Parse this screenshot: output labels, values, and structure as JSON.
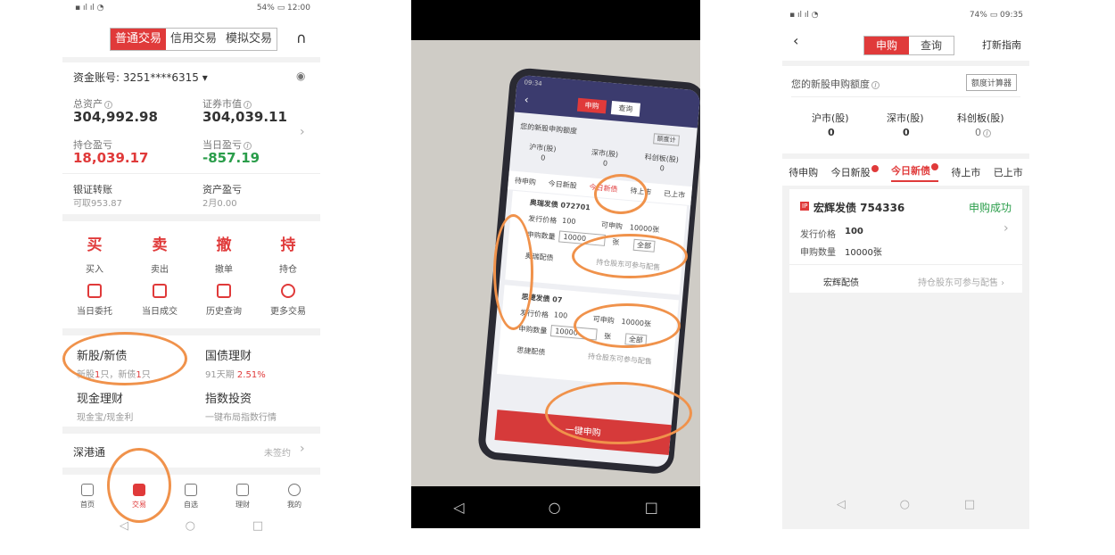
{
  "p1": {
    "status_right": "54% ▭ 12:00",
    "tabs": [
      "普通交易",
      "信用交易",
      "模拟交易"
    ],
    "account_label": "资金账号: 3251****6315",
    "total_asset_label": "总资产",
    "total_asset": "304,992.98",
    "market_value_label": "证券市值",
    "market_value": "304,039.11",
    "hold_pnl_label": "持仓盈亏",
    "hold_pnl": "18,039.17",
    "day_pnl_label": "当日盈亏",
    "day_pnl": "-857.19",
    "bank_label": "银证转账",
    "bank_sub": "可取953.87",
    "asset_pnl_label": "资产盈亏",
    "asset_pnl_sub": "2月0.00",
    "actions": [
      {
        "big": "买",
        "sm": "买入"
      },
      {
        "big": "卖",
        "sm": "卖出"
      },
      {
        "big": "撤",
        "sm": "撤单"
      },
      {
        "big": "持",
        "sm": "持仓"
      }
    ],
    "icons": [
      "当日委托",
      "当日成交",
      "历史查询",
      "更多交易"
    ],
    "ipo_title": "新股/新债",
    "ipo_sub_a": "新股",
    "ipo_sub_n1": "1",
    "ipo_sub_b": "只，新债",
    "ipo_sub_n2": "1",
    "ipo_sub_c": "只",
    "bond_title": "国债理财",
    "bond_sub_a": "91天期",
    "bond_sub_b": "2.51%",
    "cash_title": "现金理财",
    "cash_sub": "现金宝/现金利",
    "index_title": "指数投资",
    "index_sub": "一键布局指数行情",
    "sgt_title": "深港通",
    "sgt_status": "未签约",
    "nav": [
      "首页",
      "交易",
      "自选",
      "理财",
      "我的"
    ]
  },
  "p2": {
    "status": "09:34",
    "tabs": [
      "申购",
      "查询"
    ],
    "quota_label": "您的新股申购额度",
    "calc": "额度计",
    "markets": [
      "沪市(股)",
      "深市(股)",
      "科创板(股)"
    ],
    "market_vals": [
      "0",
      "0",
      "0"
    ],
    "subtabs": [
      "待申购",
      "今日新股",
      "今日新债",
      "待上市",
      "已上市"
    ],
    "item1_name": "奥瑞发债 072701",
    "item2_name": "思捷发债 07",
    "price_label": "发行价格",
    "price": "100",
    "qty_label": "申购数量",
    "qty": "10000",
    "can_label": "可申购",
    "can_val": "10000张",
    "unit": "张",
    "all": "全部",
    "placement1": "奥瑞配债",
    "placement2": "思捷配债",
    "placement_tip": "持仓股东可参与配售",
    "select_all": "全选",
    "submit": "一键申购"
  },
  "p3": {
    "status_right": "74% ▭ 09:35",
    "seg": [
      "申购",
      "查询"
    ],
    "guide": "打新指南",
    "quota_label": "您的新股申购额度",
    "calc_btn": "额度计算器",
    "markets": [
      "沪市(股)",
      "深市(股)",
      "科创板(股)"
    ],
    "market_vals": [
      "0",
      "0",
      "0"
    ],
    "tabs": [
      "待申购",
      "今日新股",
      "今日新债",
      "待上市",
      "已上市"
    ],
    "tab_badge": "1",
    "bond_tag": "IP",
    "bond_name": "宏辉发债 754336",
    "bond_status": "申购成功",
    "price_label": "发行价格",
    "price": "100",
    "qty_label": "申购数量",
    "qty": "10000张",
    "placement": "宏辉配债",
    "placement_tip": "持仓股东可参与配售"
  },
  "colors": {
    "accent": "#e03a3a",
    "down": "#2a9d4a",
    "annotation": "#f0924b"
  }
}
